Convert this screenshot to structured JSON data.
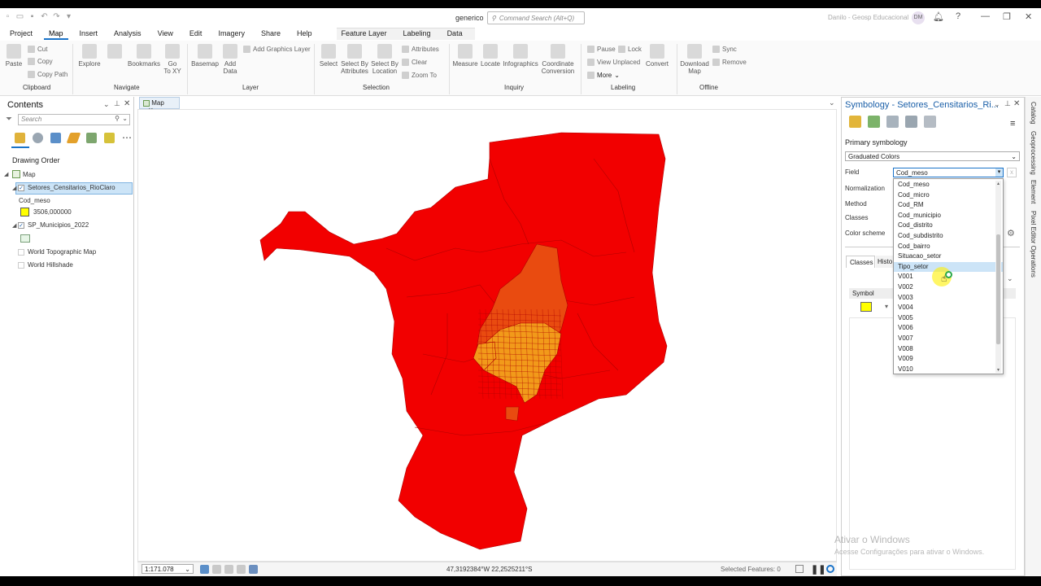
{
  "window": {
    "title": "generico",
    "command_search_placeholder": "Command Search (Alt+Q)",
    "user": "Danilo - Geosp Educacional",
    "avatar": "DM"
  },
  "ribbon_tabs": [
    "Project",
    "Map",
    "Insert",
    "Analysis",
    "View",
    "Edit",
    "Imagery",
    "Share",
    "Help",
    "Feature Layer",
    "Labeling",
    "Data"
  ],
  "ribbon": {
    "clipboard": {
      "paste": "Paste",
      "cut": "Cut",
      "copy": "Copy",
      "copy_path": "Copy Path",
      "group": "Clipboard"
    },
    "navigate": {
      "explore": "Explore",
      "bookmarks": "Bookmarks",
      "go_to_xy": "Go\nTo XY",
      "group": "Navigate"
    },
    "layer": {
      "basemap": "Basemap",
      "add_data": "Add\nData",
      "add_graphics": "Add Graphics Layer",
      "group": "Layer"
    },
    "selection": {
      "select": "Select",
      "select_by_attributes": "Select By\nAttributes",
      "select_by_location": "Select By\nLocation",
      "attributes": "Attributes",
      "clear": "Clear",
      "zoom_to": "Zoom To",
      "group": "Selection"
    },
    "inquiry": {
      "measure": "Measure",
      "locate": "Locate",
      "infographics": "Infographics",
      "coordinate_conversion": "Coordinate\nConversion",
      "group": "Inquiry"
    },
    "labeling": {
      "pause": "Pause",
      "lock": "Lock",
      "view_unplaced": "View Unplaced",
      "more": "More",
      "convert": "Convert",
      "group": "Labeling"
    },
    "offline": {
      "download_map": "Download\nMap",
      "sync": "Sync",
      "remove": "Remove",
      "group": "Offline"
    }
  },
  "contents": {
    "title": "Contents",
    "search_placeholder": "Search",
    "drawing_order": "Drawing Order",
    "map_node": "Map",
    "layers": [
      {
        "name": "Setores_Censitarios_RioClaro",
        "checked": true,
        "selected": true
      },
      {
        "name": "SP_Municipios_2022",
        "checked": true
      }
    ],
    "legend_field": "Cod_meso",
    "legend_value": "3506,000000",
    "basemaps": [
      "World Topographic Map",
      "World Hillshade"
    ]
  },
  "map_view": {
    "tab": "Map",
    "scale": "1:171.078",
    "coordinates": "47,3192384°W 22,2525211°S",
    "selected_features": "Selected Features: 0",
    "colors": {
      "outer": "#f20000",
      "mid": "#e94b10",
      "inner": "#f29a1a",
      "line": "#b00000"
    }
  },
  "symbology": {
    "title": "Symbology - Setores_Censitarios_Ri...",
    "primary": "Primary symbology",
    "renderer": "Graduated Colors",
    "field_label": "Field",
    "field_value": "Cod_meso",
    "normalization_label": "Normalization",
    "method_label": "Method",
    "classes_label": "Classes",
    "color_scheme_label": "Color scheme",
    "tab_classes": "Classes",
    "tab_histogram": "Histo",
    "symbol_header": "Symbol",
    "field_options": [
      "Cod_meso",
      "Cod_micro",
      "Cod_RM",
      "Cod_municipio",
      "Cod_distrito",
      "Cod_subdistrito",
      "Cod_bairro",
      "Situacao_setor",
      "Tipo_setor",
      "V001",
      "V002",
      "V003",
      "V004",
      "V005",
      "V006",
      "V007",
      "V008",
      "V009",
      "V010"
    ],
    "highlighted_option": "Tipo_setor"
  },
  "side_tabs": [
    "Catalog",
    "Geoprocessing",
    "Element",
    "Pixel Editor Operations"
  ],
  "watermark": {
    "line1": "Ativar o Windows",
    "line2": "Acesse Configurações para ativar o Windows."
  }
}
